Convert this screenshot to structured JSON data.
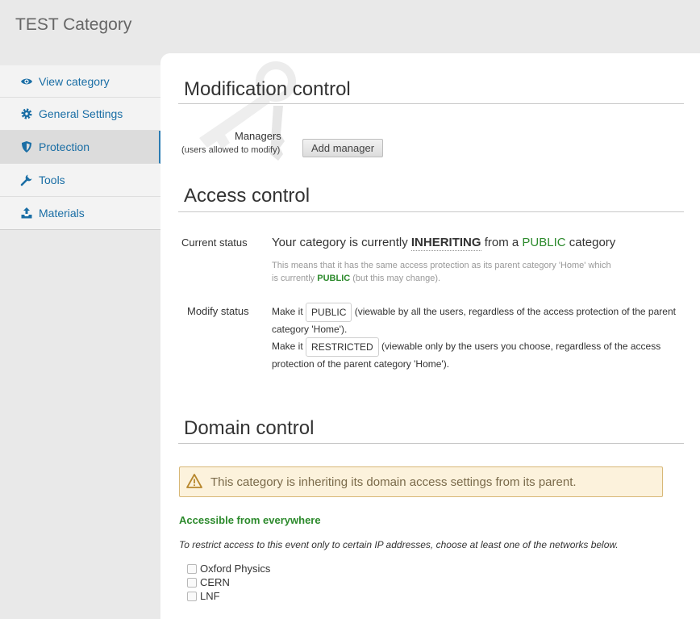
{
  "header": {
    "title": "TEST Category"
  },
  "sidebar": {
    "items": [
      {
        "label": "View category",
        "icon": "eye-icon"
      },
      {
        "label": "General Settings",
        "icon": "gear-icon"
      },
      {
        "label": "Protection",
        "icon": "shield-icon",
        "active": true
      },
      {
        "label": "Tools",
        "icon": "wrench-icon"
      },
      {
        "label": "Materials",
        "icon": "upload-icon"
      }
    ]
  },
  "modification": {
    "title": "Modification control",
    "managers_label": "Managers",
    "managers_hint": "(users allowed to modify)",
    "add_manager_label": "Add manager"
  },
  "access": {
    "title": "Access control",
    "current_status_label": "Current status",
    "status_prefix": "Your category is currently",
    "status_value": "INHERITING",
    "status_middle": "from a",
    "status_parent": "PUBLIC",
    "status_suffix": "category",
    "note_line1": "This means that it has the same access protection as its parent category 'Home' which",
    "note_line2_prefix": "is currently",
    "note_line2_value": "PUBLIC",
    "note_line2_suffix": "(but this may change).",
    "modify_status_label": "Modify status",
    "make_it": "Make it",
    "public_button": "PUBLIC",
    "public_desc": "(viewable by all the users, regardless of the access protection of the parent category 'Home').",
    "restricted_button": "RESTRICTED",
    "restricted_desc": "(viewable only by the users you choose, regardless of the access protection of the parent category 'Home')."
  },
  "domain": {
    "title": "Domain control",
    "alert_text": "This category is inheriting its domain access settings from its parent.",
    "accessible_label": "Accessible from everywhere",
    "restrict_note": "To restrict access to this event only to certain IP addresses, choose at least one of the networks below.",
    "networks": [
      "Oxford Physics",
      "CERN",
      "LNF"
    ]
  },
  "colors": {
    "accent": "#1a6ea5",
    "green": "#2c8a2c",
    "warning_bg": "#fcf2dc"
  }
}
